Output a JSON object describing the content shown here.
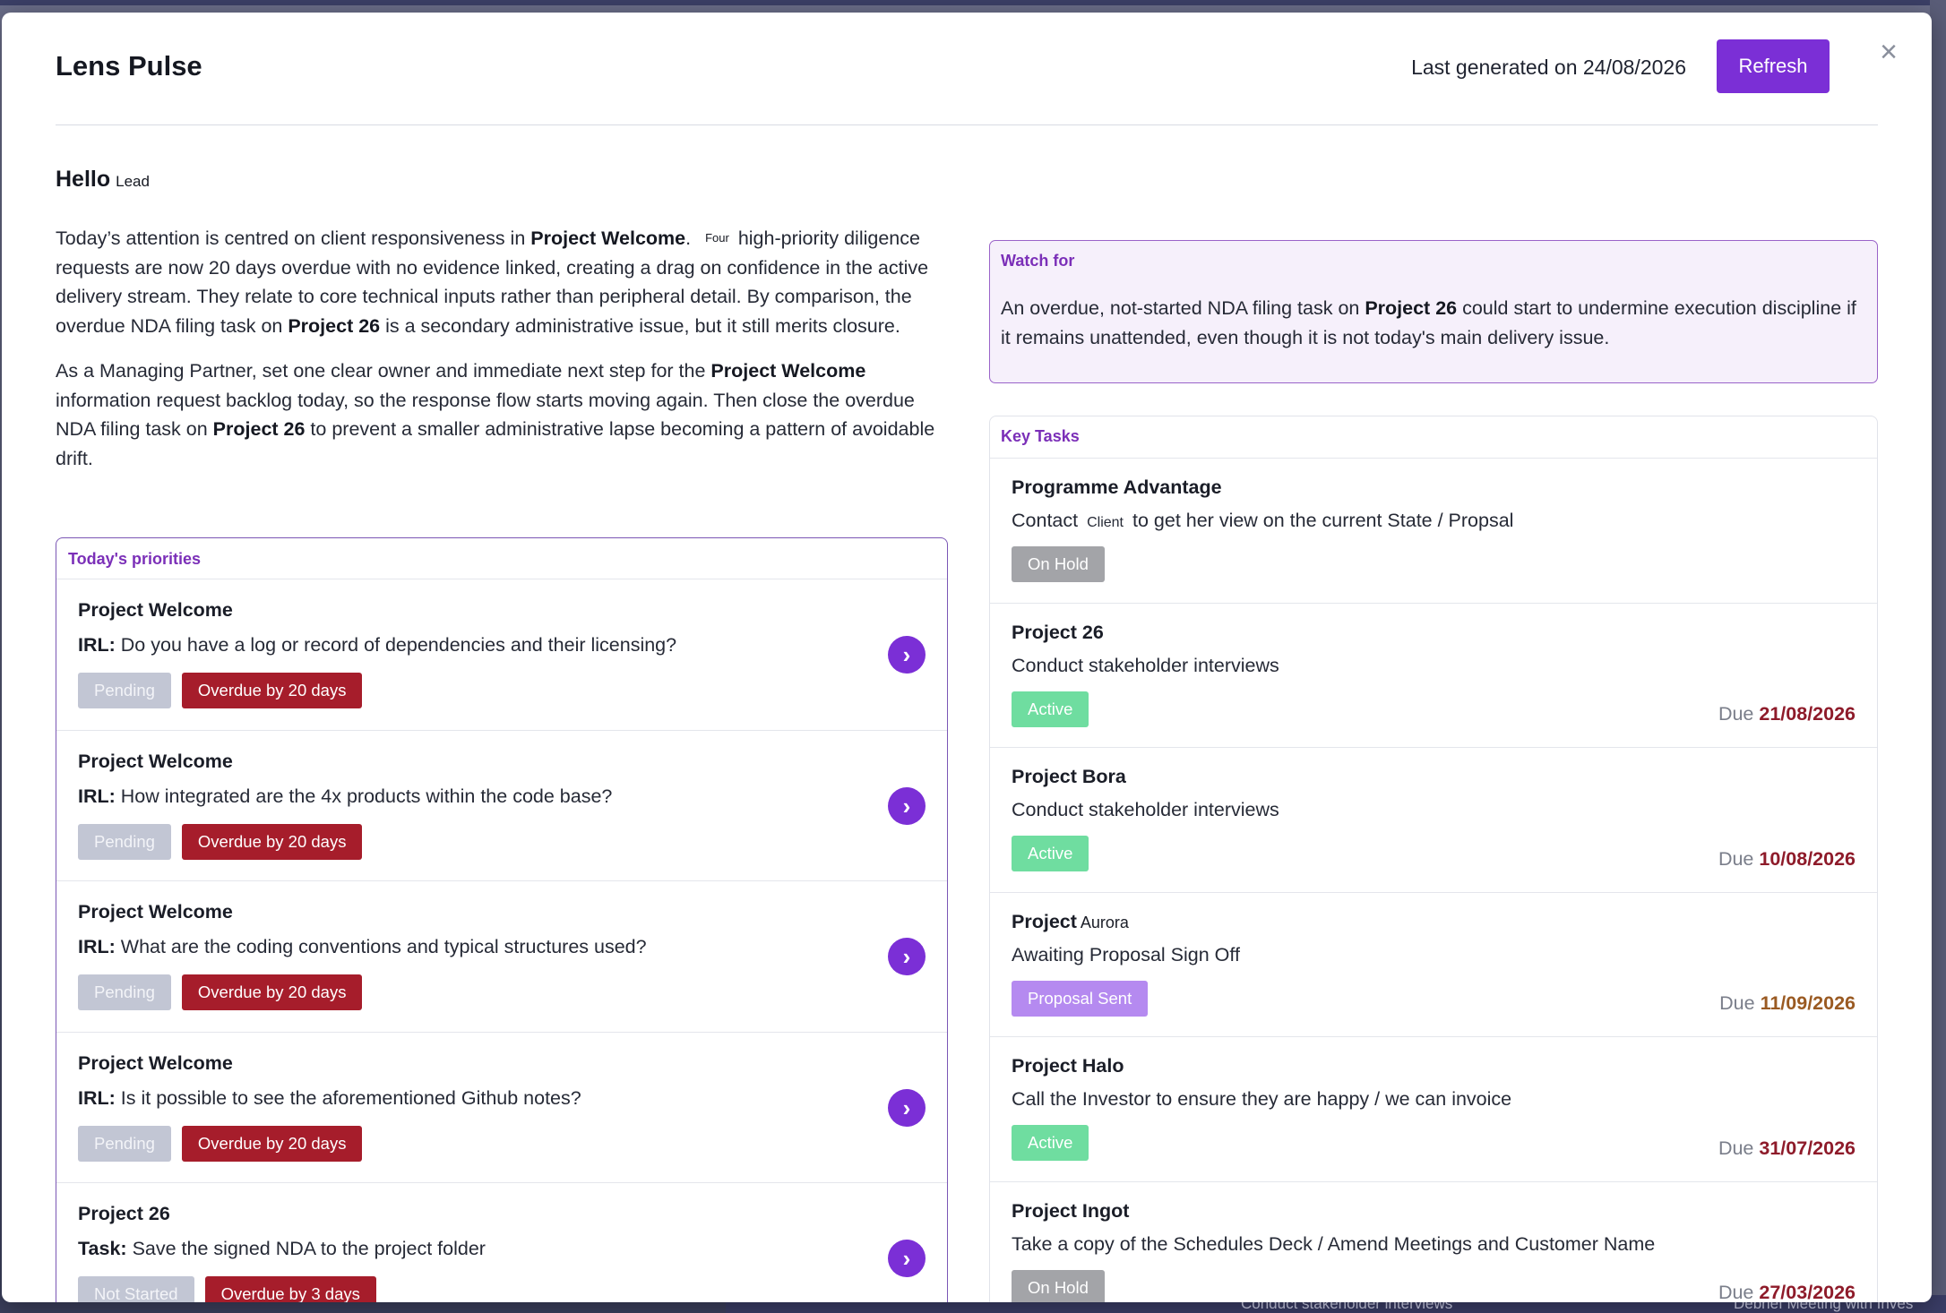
{
  "background": {
    "bottom_items": [
      "Conduct stakeholder interviews",
      "Debrief Meeting with Inves"
    ]
  },
  "modal": {
    "title": "Lens Pulse",
    "last_generated": "Last generated on 24/08/2026",
    "refresh_label": "Refresh",
    "close_glyph": "×"
  },
  "greeting": {
    "hello": "Hello",
    "role": "Lead"
  },
  "summary": {
    "p1": {
      "a": "Today’s attention is centred on client responsiveness in ",
      "b": "Project Welcome",
      "c": ". ",
      "chip": "Four",
      "d": "high-priority diligence requests are now 20 days overdue with no evidence linked, creating a drag on confidence in the active delivery stream. They relate to core technical inputs rather than peripheral detail. By comparison, the overdue NDA filing task on ",
      "e": "Project 26",
      "f": " is a secondary administrative issue, but it still merits closure."
    },
    "p2": {
      "a": "As a Managing Partner, set one clear owner and immediate next step for the ",
      "b": "Project Welcome",
      "c": " information request backlog today, so the response flow starts moving again. Then close the overdue NDA filing task on ",
      "d": "Project 26",
      "e": " to prevent a smaller administrative lapse becoming a pattern of avoidable drift."
    }
  },
  "priorities": {
    "label": "Today's priorities",
    "items": [
      {
        "project": "Project Welcome",
        "kind": "IRL:",
        "text": "Do you have a log or record of dependencies and their licensing?",
        "status": "Pending",
        "overdue": "Overdue by 20 days"
      },
      {
        "project": "Project Welcome",
        "kind": "IRL:",
        "text": "How integrated are the 4x products within the code base?",
        "status": "Pending",
        "overdue": "Overdue by 20 days"
      },
      {
        "project": "Project Welcome",
        "kind": "IRL:",
        "text": "What are the coding conventions and typical structures used?",
        "status": "Pending",
        "overdue": "Overdue by 20 days"
      },
      {
        "project": "Project Welcome",
        "kind": "IRL:",
        "text": "Is it possible to see the aforementioned Github notes?",
        "status": "Pending",
        "overdue": "Overdue by 20 days"
      },
      {
        "project": "Project 26",
        "kind": "Task:",
        "text": "Save the signed NDA to the project folder",
        "status": "Not Started",
        "overdue": "Overdue by 3 days"
      }
    ],
    "arrow_glyph": "›"
  },
  "watch": {
    "label": "Watch for",
    "a": "An overdue, not-started NDA filing task on ",
    "b": "Project 26",
    "c": " could start to undermine execution discipline if it remains unattended, even though it is not today's main delivery issue."
  },
  "key_tasks": {
    "label": "Key Tasks",
    "due_prefix": "Due",
    "items": [
      {
        "project": "Programme Advantage",
        "project_suffix": "",
        "text_a": "Contact",
        "chip": "Client",
        "text_b": "to get her view on the current State / Propsal",
        "status": "On Hold",
        "due": ""
      },
      {
        "project": "Project 26",
        "project_suffix": "",
        "text_a": "Conduct stakeholder interviews",
        "chip": "",
        "text_b": "",
        "status": "Active",
        "due": "21/08/2026"
      },
      {
        "project": "Project Bora",
        "project_suffix": "",
        "text_a": "Conduct stakeholder interviews",
        "chip": "",
        "text_b": "",
        "status": "Active",
        "due": "10/08/2026"
      },
      {
        "project": "Project",
        "project_suffix": "Aurora",
        "text_a": "Awaiting Proposal Sign Off",
        "chip": "",
        "text_b": "",
        "status": "Proposal Sent",
        "due": "11/09/2026"
      },
      {
        "project": "Project Halo",
        "project_suffix": "",
        "text_a": "Call the Investor to ensure they are happy / we can invoice",
        "chip": "",
        "text_b": "",
        "status": "Active",
        "due": "31/07/2026"
      },
      {
        "project": "Project Ingot",
        "project_suffix": "",
        "text_a": "Take a copy of the Schedules Deck / Amend Meetings and Customer Name",
        "chip": "",
        "text_b": "",
        "status": "On Hold",
        "due": "27/03/2026"
      }
    ]
  },
  "colors": {
    "accent": "#7b2fd6",
    "overdue": "#a61d2b",
    "active": "#6fdda0",
    "on_hold": "#a3a4a8",
    "proposal": "#b58af0"
  }
}
